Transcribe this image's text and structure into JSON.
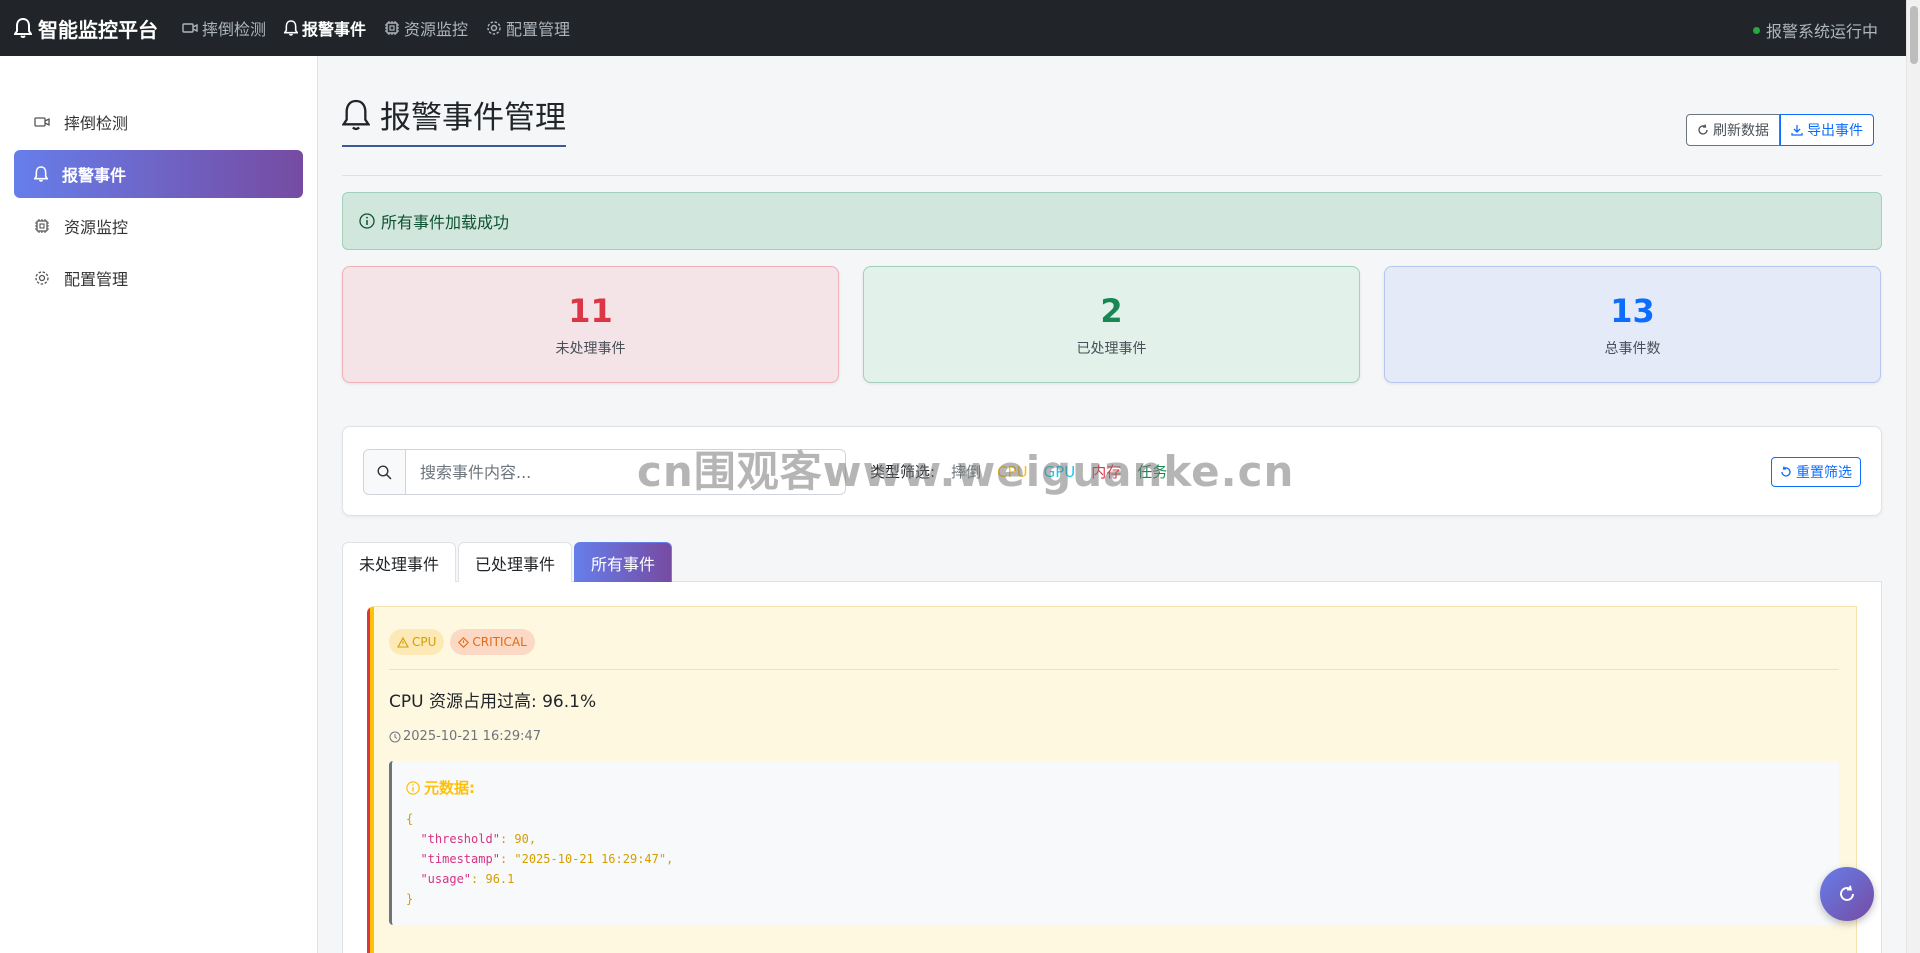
{
  "navbar": {
    "brand": "智能监控平台",
    "links": [
      {
        "label": "摔倒检测",
        "icon": "camera-icon"
      },
      {
        "label": "报警事件",
        "icon": "bell-icon"
      },
      {
        "label": "资源监控",
        "icon": "cpu-icon"
      },
      {
        "label": "配置管理",
        "icon": "gear-icon"
      }
    ],
    "status": "报警系统运行中",
    "status_color": "#28a745"
  },
  "sidebar": {
    "items": [
      {
        "label": "摔倒检测",
        "icon": "camera-icon"
      },
      {
        "label": "报警事件",
        "icon": "bell-icon"
      },
      {
        "label": "资源监控",
        "icon": "cpu-icon"
      },
      {
        "label": "配置管理",
        "icon": "gear-icon"
      }
    ]
  },
  "page": {
    "title": "报警事件管理",
    "refresh_label": "刷新数据",
    "export_label": "导出事件"
  },
  "alert": {
    "message": "所有事件加载成功"
  },
  "stats": {
    "unhandled": {
      "value": "11",
      "label": "未处理事件"
    },
    "handled": {
      "value": "2",
      "label": "已处理事件"
    },
    "total": {
      "value": "13",
      "label": "总事件数"
    }
  },
  "filter": {
    "search_placeholder": "搜索事件内容...",
    "type_label": "类型筛选:",
    "types": [
      "摔倒",
      "CPU",
      "GPU",
      "内存",
      "任务"
    ],
    "reset_label": "重置筛选"
  },
  "watermark": "cn围观客www.weiguanke.cn",
  "tabs": [
    {
      "label": "未处理事件"
    },
    {
      "label": "已处理事件"
    },
    {
      "label": "所有事件"
    }
  ],
  "event": {
    "badge_type": "CPU",
    "badge_level": "CRITICAL",
    "title": "CPU 资源占用过高: 96.1%",
    "time": "2025-10-21 16:29:47",
    "meta_title": "元数据:",
    "meta": {
      "open": "{",
      "line1_key": "\"threshold\"",
      "line1_val": ": 90,",
      "line2_key": "\"timestamp\"",
      "line2_val": ": \"2025-10-21 16:29:47\",",
      "line3_key": "\"usage\"",
      "line3_val": ": 96.1",
      "close": "}"
    }
  },
  "colors": {
    "accent_start": "#667eea",
    "accent_end": "#764ba2",
    "danger": "#dc3545",
    "success": "#198754",
    "primary": "#0d6efd",
    "warning": "#ffc107"
  }
}
